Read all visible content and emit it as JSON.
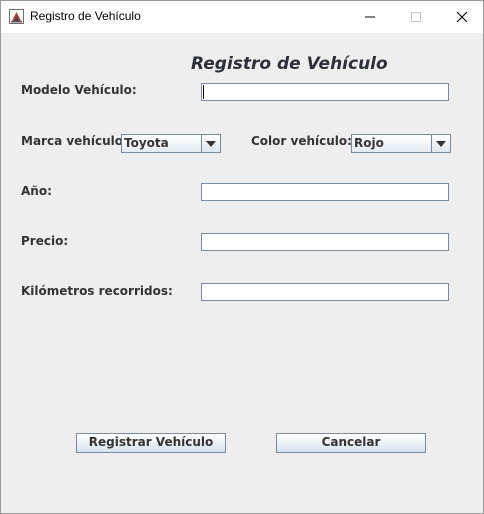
{
  "window": {
    "title": "Registro de Vehículo",
    "icon": "java-app-icon"
  },
  "form": {
    "heading": "Registro de Vehículo",
    "modelo_label": "Modelo Vehículo:",
    "modelo_value": "",
    "marca_label": "Marca vehículo:",
    "marca_selected": "Toyota",
    "color_label": "Color vehículo:",
    "color_selected": "Rojo",
    "anio_label": "Año:",
    "anio_value": "",
    "precio_label": "Precio:",
    "precio_value": "",
    "km_label": "Kilómetros recorridos:",
    "km_value": ""
  },
  "buttons": {
    "register": "Registrar Vehículo",
    "cancel": "Cancelar"
  }
}
